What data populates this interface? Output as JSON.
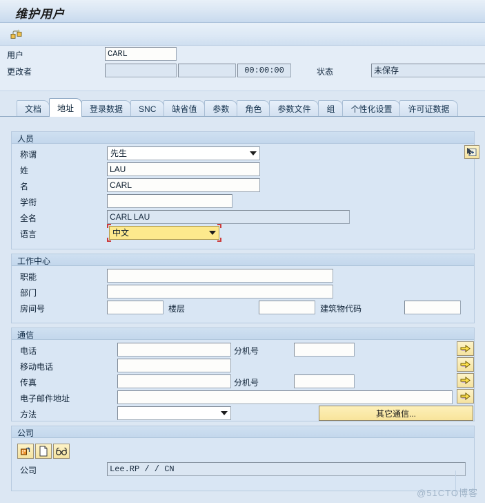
{
  "window": {
    "title": "维护用户"
  },
  "toolbar": {
    "buttons": [
      {
        "name": "assign-object-button",
        "icon": "copy-object-icon",
        "label": ""
      }
    ]
  },
  "header": {
    "user_label": "用户",
    "user_value": "CARL",
    "changed_by_label": "更改者",
    "changed_by_value": "",
    "changed_date_value": "",
    "changed_time_value": "00:00:00",
    "status_label": "状态",
    "status_value": "未保存"
  },
  "tabs": [
    {
      "label": "文档",
      "active": false
    },
    {
      "label": "地址",
      "active": true
    },
    {
      "label": "登录数据",
      "active": false
    },
    {
      "label": "SNC",
      "active": false
    },
    {
      "label": "缺省值",
      "active": false
    },
    {
      "label": "参数",
      "active": false
    },
    {
      "label": "角色",
      "active": false
    },
    {
      "label": "参数文件",
      "active": false
    },
    {
      "label": "组",
      "active": false
    },
    {
      "label": "个性化设置",
      "active": false
    },
    {
      "label": "许可证数据",
      "active": false
    }
  ],
  "person": {
    "group_title": "人员",
    "salutation_label": "称谓",
    "salutation_value": "先生",
    "last_name_label": "姓",
    "last_name_value": "LAU",
    "first_name_label": "名",
    "first_name_value": "CARL",
    "academic_title_label": "学衔",
    "academic_title_value": "",
    "full_name_label": "全名",
    "full_name_value": "CARL LAU",
    "language_label": "语言",
    "language_value": "中文",
    "detail_button_icon": "cursor-plus-icon"
  },
  "workcenter": {
    "group_title": "工作中心",
    "function_label": "职能",
    "function_value": "",
    "department_label": "部门",
    "department_value": "",
    "room_label": "房间号",
    "room_value": "",
    "floor_label": "楼层",
    "floor_value": "",
    "building_label": "建筑物代码",
    "building_value": ""
  },
  "communication": {
    "group_title": "通信",
    "phone_label": "电话",
    "phone_value": "",
    "phone_ext_label": "分机号",
    "phone_ext_value": "",
    "mobile_label": "移动电话",
    "mobile_value": "",
    "fax_label": "传真",
    "fax_value": "",
    "fax_ext_label": "分机号",
    "fax_ext_value": "",
    "email_label": "电子邮件地址",
    "email_value": "",
    "method_label": "方法",
    "method_value": "",
    "other_comm_button": "其它通信...",
    "arrow_button_icon": "yellow-arrow-right-icon"
  },
  "company": {
    "group_title": "公司",
    "toolbar_icons": [
      {
        "name": "assign-company-icon"
      },
      {
        "name": "new-company-icon"
      },
      {
        "name": "display-company-icon"
      }
    ],
    "company_label": "公司",
    "company_value": "Lee.RP /    / CN"
  },
  "watermark": "@51CTO博客",
  "colors": {
    "page_bg": "#dce7f3",
    "group_bg": "#d9e6f4",
    "field_bg": "#ffffff",
    "readonly_bg": "#dbe6f2",
    "focus_yellow": "#fde98d",
    "focus_red": "#cc3b3b",
    "button_yellow": "#f8e49b",
    "tab_active_bg": "#ffffff"
  }
}
